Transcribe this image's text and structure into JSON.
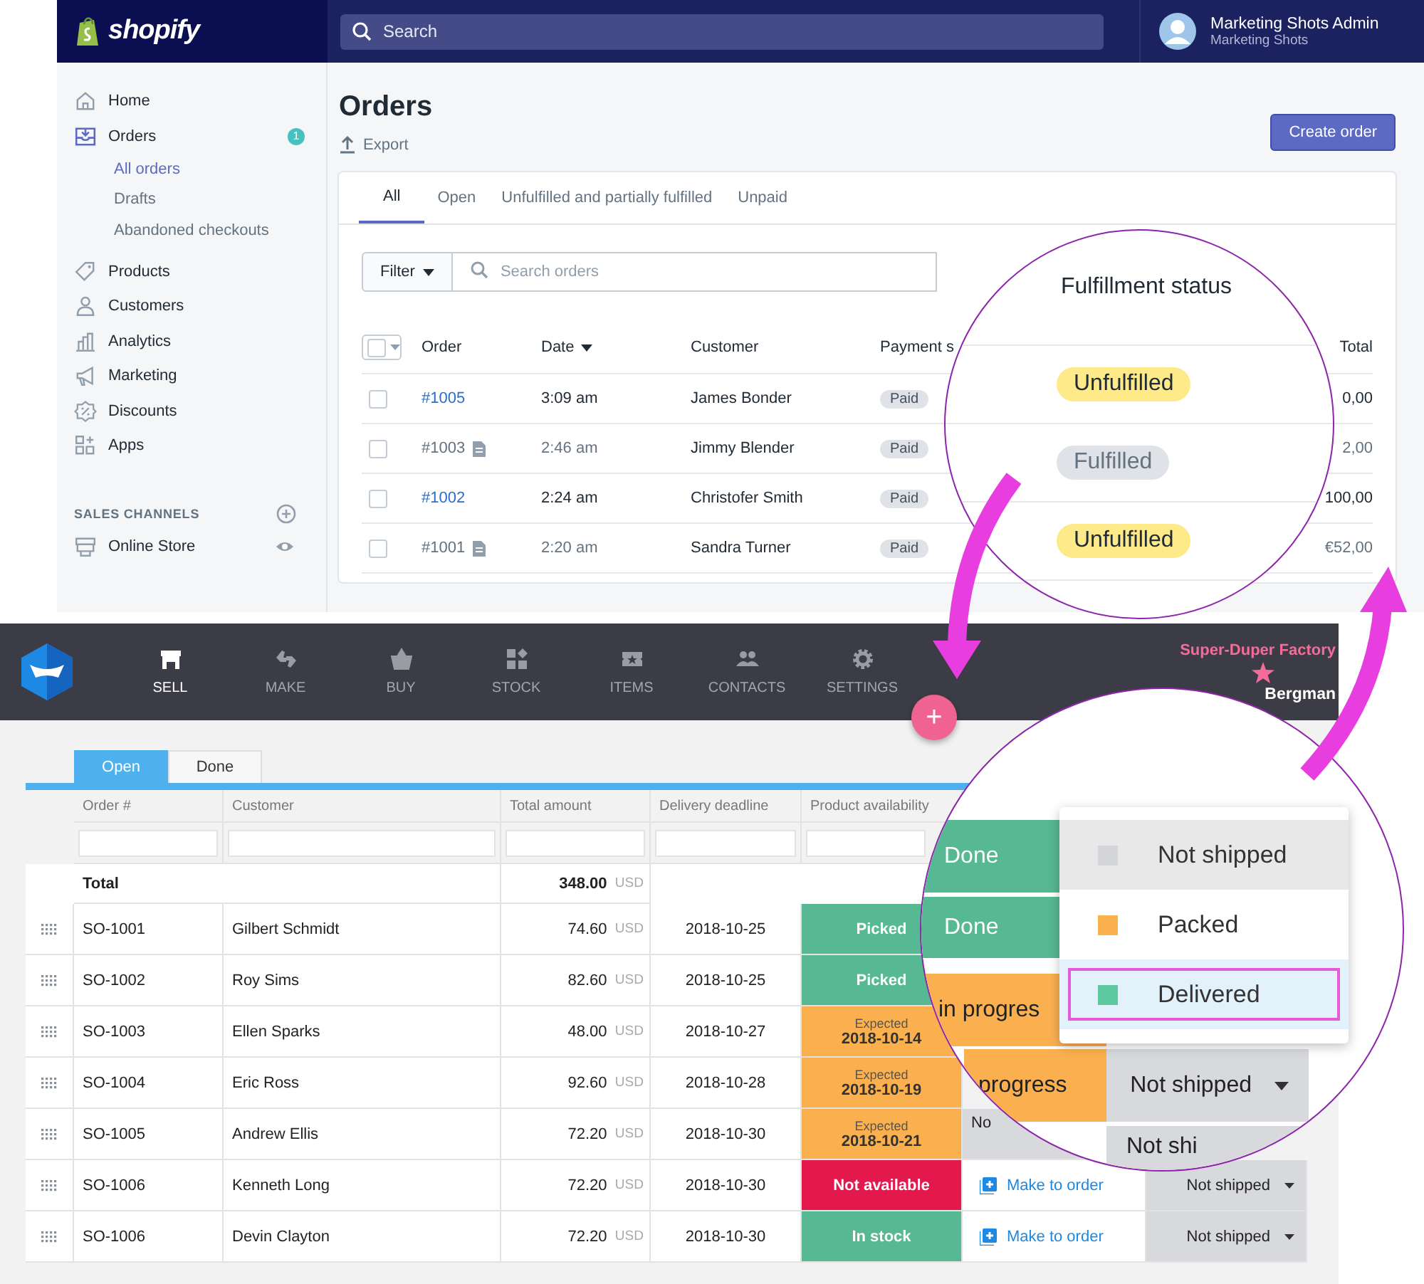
{
  "admin_window": {
    "brand": "shopify",
    "search": {
      "placeholder": "Search"
    },
    "user": {
      "name": "Marketing Shots Admin",
      "store": "Marketing Shots"
    },
    "sidebar": {
      "items": [
        {
          "kind": "home",
          "label": "Home",
          "selected": false
        },
        {
          "kind": "orders",
          "label": "Orders",
          "selected": true,
          "badge": "1",
          "children": [
            {
              "label": "All orders",
              "selected": true
            },
            {
              "label": "Drafts",
              "selected": false
            },
            {
              "label": "Abandoned checkouts",
              "selected": false
            }
          ]
        },
        {
          "kind": "products",
          "label": "Products",
          "selected": false
        },
        {
          "kind": "customers",
          "label": "Customers",
          "selected": false
        },
        {
          "kind": "analytics",
          "label": "Analytics",
          "selected": false
        },
        {
          "kind": "marketing",
          "label": "Marketing",
          "selected": false
        },
        {
          "kind": "discounts",
          "label": "Discounts",
          "selected": false
        },
        {
          "kind": "apps",
          "label": "Apps",
          "selected": false
        }
      ],
      "section_title": "SALES CHANNELS",
      "channels": [
        {
          "kind": "store",
          "label": "Online Store"
        }
      ]
    },
    "page_title": "Orders",
    "export_label": "Export",
    "create_button": "Create order",
    "tabs": [
      {
        "label": "All",
        "selected": true
      },
      {
        "label": "Open",
        "selected": false
      },
      {
        "label": "Unfulfilled and partially fulfilled",
        "selected": false
      },
      {
        "label": "Unpaid",
        "selected": false
      }
    ],
    "filter_button": "Filter",
    "search_orders": {
      "placeholder": "Search orders"
    },
    "table": {
      "select_all": {
        "checked": false
      },
      "columns": [
        "Order",
        "Date",
        "Customer",
        "Payment s",
        "Total"
      ],
      "rows": [
        {
          "checked": false,
          "order": "#1005",
          "linked": true,
          "date": "3:09 am",
          "customer": "James Bonder",
          "payment": "Paid",
          "total": "0,00"
        },
        {
          "checked": false,
          "order": "#1003",
          "linked": false,
          "date": "2:46 am",
          "customer": "Jimmy Blender",
          "payment": "Paid",
          "total": "2,00"
        },
        {
          "checked": false,
          "order": "#1002",
          "linked": true,
          "date": "2:24 am",
          "customer": "Christofer Smith",
          "payment": "Paid",
          "total": "100,00"
        },
        {
          "checked": false,
          "order": "#1001",
          "linked": false,
          "date": "2:20 am",
          "customer": "Sandra Turner",
          "payment": "Paid",
          "total": "€52,00"
        }
      ]
    }
  },
  "factory_window": {
    "nav": [
      {
        "kind": "sell",
        "label": "SELL",
        "selected": true
      },
      {
        "kind": "make",
        "label": "MAKE",
        "selected": false
      },
      {
        "kind": "buy",
        "label": "BUY",
        "selected": false
      },
      {
        "kind": "stock",
        "label": "STOCK",
        "selected": false
      },
      {
        "kind": "items",
        "label": "ITEMS",
        "selected": false
      },
      {
        "kind": "contacts",
        "label": "CONTACTS",
        "selected": false
      },
      {
        "kind": "settings",
        "label": "SETTINGS",
        "selected": false
      }
    ],
    "company": "Super-Duper Factory",
    "user_name": "Bergman",
    "add_button": "+",
    "tabs": [
      {
        "label": "Open",
        "selected": true
      },
      {
        "label": "Done",
        "selected": false
      }
    ],
    "table": {
      "columns": [
        "Order #",
        "Customer",
        "Total amount",
        "Delivery deadline",
        "Product availability"
      ],
      "total": {
        "label": "Total",
        "amount": "348.00",
        "currency": "USD"
      },
      "rows": [
        {
          "order": "SO-1001",
          "customer": "Gilbert Schmidt",
          "amount": "74.60",
          "currency": "USD",
          "deadline": "2018-10-25",
          "availability": {
            "kind": "picked",
            "label": "Picked"
          }
        },
        {
          "order": "SO-1002",
          "customer": "Roy Sims",
          "amount": "82.60",
          "currency": "USD",
          "deadline": "2018-10-25",
          "availability": {
            "kind": "picked",
            "label": "Picked"
          }
        },
        {
          "order": "SO-1003",
          "customer": "Ellen Sparks",
          "amount": "48.00",
          "currency": "USD",
          "deadline": "2018-10-27",
          "availability": {
            "kind": "expected",
            "label": "Expected",
            "date": "2018-10-14"
          }
        },
        {
          "order": "SO-1004",
          "customer": "Eric Ross",
          "amount": "92.60",
          "currency": "USD",
          "deadline": "2018-10-28",
          "availability": {
            "kind": "expected",
            "label": "Expected",
            "date": "2018-10-19"
          }
        },
        {
          "order": "SO-1005",
          "customer": "Andrew Ellis",
          "amount": "72.20",
          "currency": "USD",
          "deadline": "2018-10-30",
          "availability": {
            "kind": "expected",
            "label": "Expected",
            "date": "2018-10-21"
          },
          "production": {
            "kind": "status",
            "text": "No"
          }
        },
        {
          "order": "SO-1006",
          "customer": "Kenneth Long",
          "amount": "72.20",
          "currency": "USD",
          "deadline": "2018-10-30",
          "availability": {
            "kind": "not_available",
            "label": "Not available"
          },
          "production": {
            "kind": "link",
            "text": "Make to order"
          },
          "delivery": "Not shipped"
        },
        {
          "order": "SO-1006",
          "customer": "Devin Clayton",
          "amount": "72.20",
          "currency": "USD",
          "deadline": "2018-10-30",
          "availability": {
            "kind": "in_stock",
            "label": "In stock"
          },
          "production": {
            "kind": "link",
            "text": "Make to order"
          },
          "delivery": "Not shipped"
        }
      ]
    }
  },
  "magnifier_fulfillment": {
    "heading": "Fulfillment status",
    "badges": [
      {
        "kind": "unfulfilled",
        "label": "Unfulfilled"
      },
      {
        "kind": "fulfilled",
        "label": "Fulfilled"
      },
      {
        "kind": "unfulfilled",
        "label": "Unfulfilled"
      }
    ]
  },
  "magnifier_delivery": {
    "cells": [
      {
        "kind": "done",
        "text": "Done"
      },
      {
        "kind": "done",
        "text": "Done"
      },
      {
        "kind": "progress",
        "text": "in progres"
      },
      {
        "kind": "progress",
        "text": "progress"
      },
      {
        "kind": "shipping",
        "text": "Not shipped"
      },
      {
        "kind": "shipping",
        "text": "Not shi"
      }
    ],
    "menu": [
      {
        "label": "Not shipped",
        "color": "#d3d5d8",
        "hovered": true,
        "selected": false
      },
      {
        "label": "Packed",
        "color": "#fbb04e",
        "hovered": false,
        "selected": false
      },
      {
        "label": "Delivered",
        "color": "#5ec8a0",
        "hovered": false,
        "selected": true
      }
    ]
  }
}
